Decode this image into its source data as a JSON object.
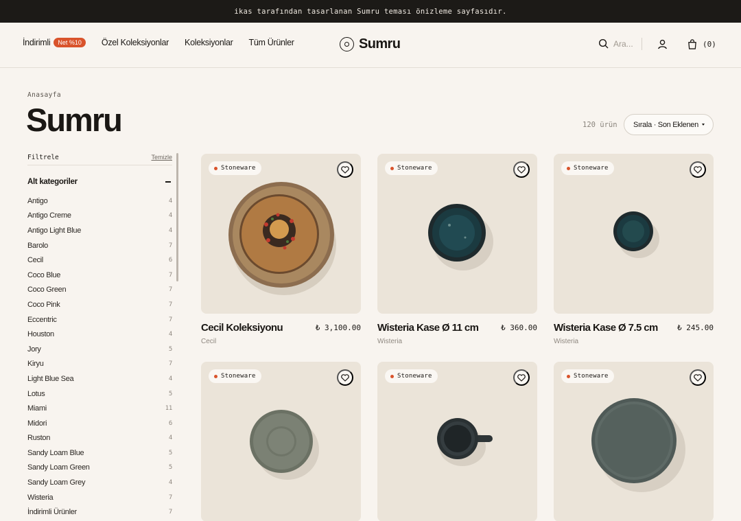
{
  "announcement": "ikas tarafından tasarlanan Sumru teması önizleme sayfasıdır.",
  "nav": {
    "discounts": "İndirimli",
    "discounts_badge": "Net %10",
    "special": "Özel Koleksiyonlar",
    "collections": "Koleksiyonlar",
    "all": "Tüm Ürünler"
  },
  "brand": "Sumru",
  "search_placeholder": "Ara...",
  "cart_count": "(0)",
  "breadcrumb": "Anasayfa",
  "page_title": "Sumru",
  "product_count": "120 ürün",
  "sort_label": "Sırala · Son Eklenen",
  "filters": {
    "title": "Filtrele",
    "clear": "Temizle",
    "section": "Alt kategoriler",
    "items": [
      {
        "label": "Antigo",
        "count": "4"
      },
      {
        "label": "Antigo Creme",
        "count": "4"
      },
      {
        "label": "Antigo Light Blue",
        "count": "4"
      },
      {
        "label": "Barolo",
        "count": "7"
      },
      {
        "label": "Cecil",
        "count": "6"
      },
      {
        "label": "Coco Blue",
        "count": "7"
      },
      {
        "label": "Coco Green",
        "count": "7"
      },
      {
        "label": "Coco Pink",
        "count": "7"
      },
      {
        "label": "Eccentric",
        "count": "7"
      },
      {
        "label": "Houston",
        "count": "4"
      },
      {
        "label": "Jory",
        "count": "5"
      },
      {
        "label": "Kiryu",
        "count": "7"
      },
      {
        "label": "Light Blue Sea",
        "count": "4"
      },
      {
        "label": "Lotus",
        "count": "5"
      },
      {
        "label": "Miami",
        "count": "11"
      },
      {
        "label": "Midori",
        "count": "6"
      },
      {
        "label": "Ruston",
        "count": "4"
      },
      {
        "label": "Sandy Loam Blue",
        "count": "5"
      },
      {
        "label": "Sandy Loam Green",
        "count": "5"
      },
      {
        "label": "Sandy Loam Grey",
        "count": "4"
      },
      {
        "label": "Wisteria",
        "count": "7"
      },
      {
        "label": "İndirimli Ürünler",
        "count": "7"
      }
    ]
  },
  "products": [
    {
      "tag": "Stoneware",
      "name": "Cecil Koleksiyonu",
      "price": "₺ 3,100.00",
      "sub": "Cecil"
    },
    {
      "tag": "Stoneware",
      "name": "Wisteria Kase Ø 11 cm",
      "price": "₺ 360.00",
      "sub": "Wisteria"
    },
    {
      "tag": "Stoneware",
      "name": "Wisteria Kase Ø 7.5 cm",
      "price": "₺ 245.00",
      "sub": "Wisteria"
    },
    {
      "tag": "Stoneware"
    },
    {
      "tag": "Stoneware"
    },
    {
      "tag": "Stoneware"
    }
  ],
  "colors": {
    "accent": "#d9532b",
    "topbar": "#1c1a17",
    "background": "#f8f4ef",
    "card": "#ebe4d9"
  }
}
